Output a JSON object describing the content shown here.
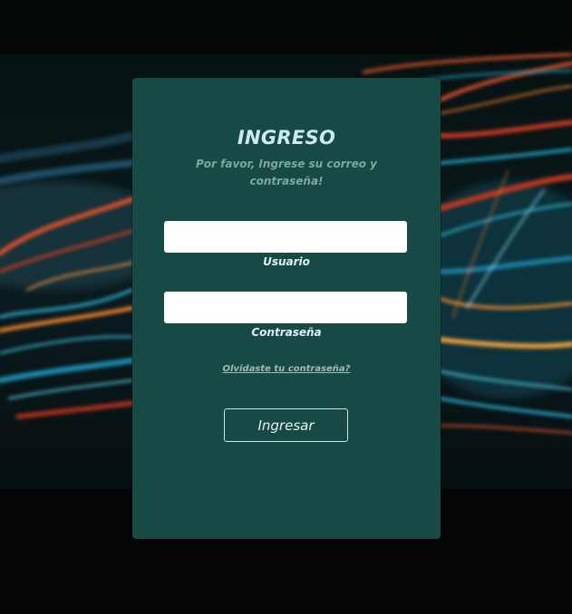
{
  "login": {
    "title": "INGRESO",
    "subtitle": "Por favor, Ingrese su correo y contraseña!",
    "username": {
      "value": "",
      "placeholder": "",
      "label": "Usuario"
    },
    "password": {
      "value": "",
      "placeholder": "",
      "label": "Contraseña"
    },
    "forgot_link": "Olvidaste tu contraseña?",
    "submit_label": "Ingresar"
  },
  "colors": {
    "page_background": "#050807",
    "card_background": "#184a45",
    "title_text": "#cfe9f1",
    "subtitle_text": "#7fa7a0",
    "label_text": "#dff0f3",
    "input_background": "#ffffff",
    "button_border": "#cfe3e0"
  },
  "background": {
    "type": "photo",
    "description_icon": "light-trails-background"
  }
}
